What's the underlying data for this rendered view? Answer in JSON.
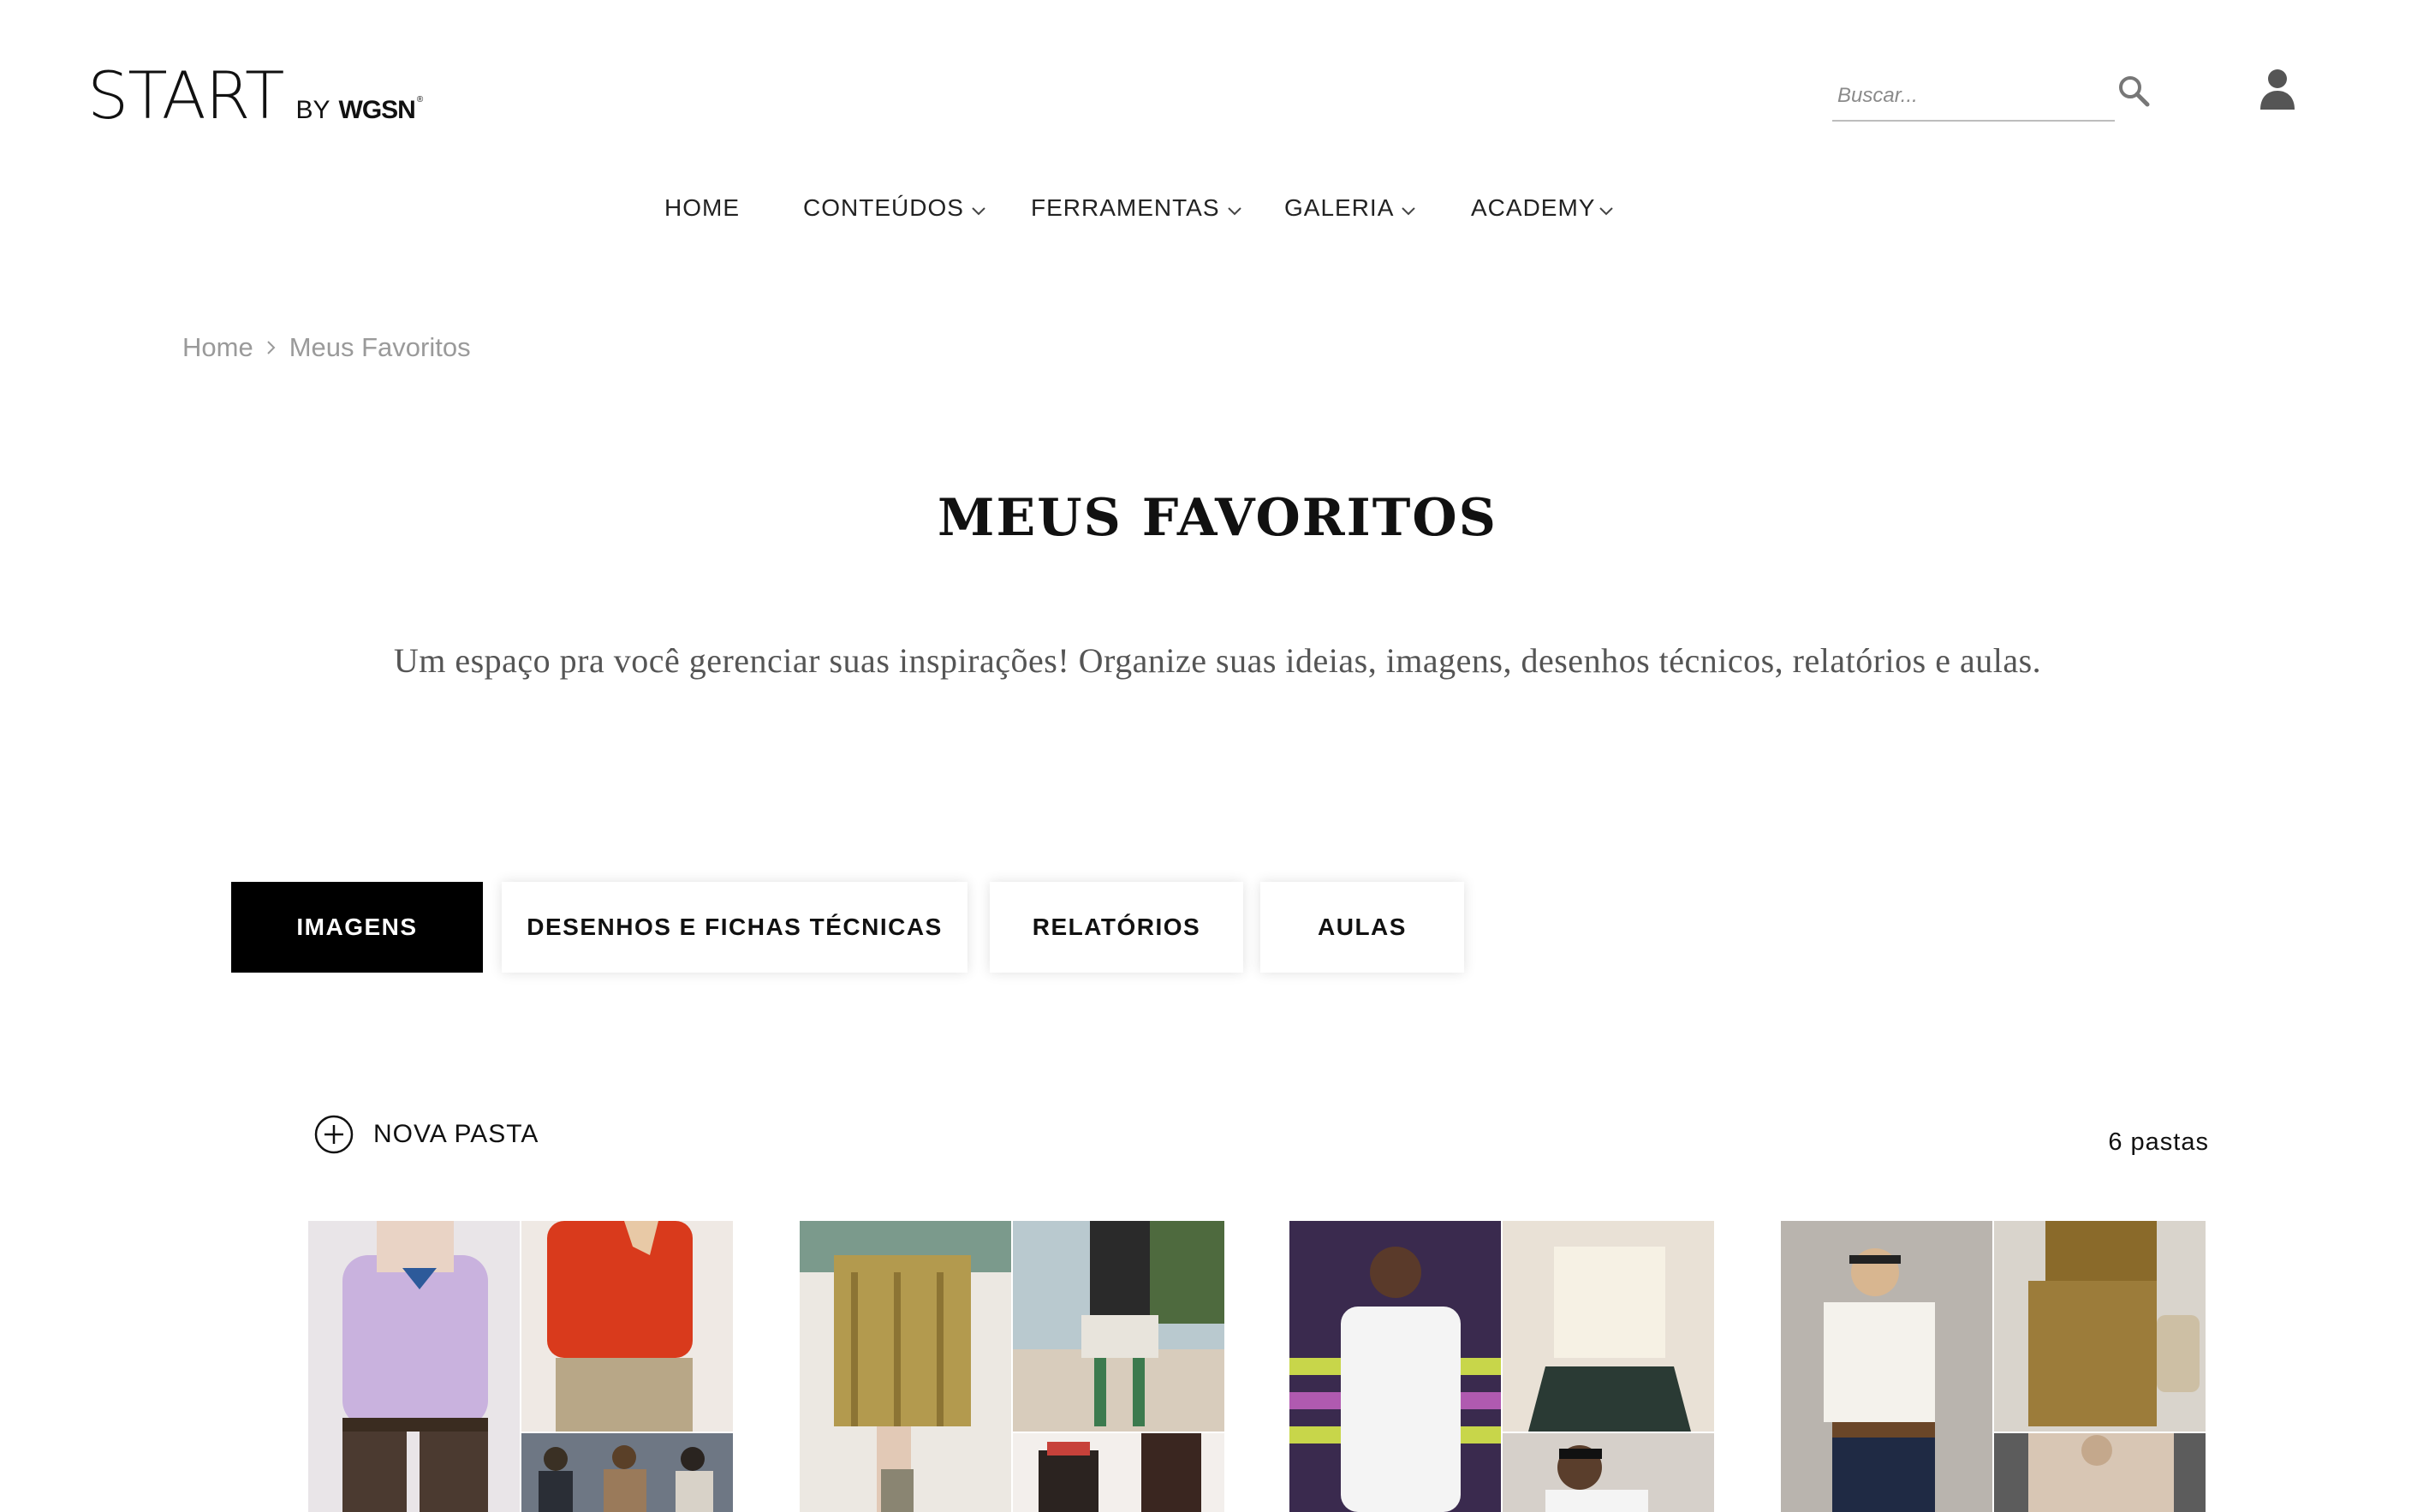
{
  "logo": {
    "main": "START",
    "by": "BY",
    "brand": "WGSN",
    "reg": "®"
  },
  "search": {
    "placeholder": "Buscar..."
  },
  "nav": {
    "home": "HOME",
    "conteudos": "CONTEÚDOS",
    "ferramentas": "FERRAMENTAS",
    "galeria": "GALERIA",
    "academy": "ACADEMY"
  },
  "breadcrumb": {
    "home": "Home",
    "current": "Meus Favoritos"
  },
  "page": {
    "title": "MEUS FAVORITOS",
    "subtitle": "Um espaço pra você gerenciar suas inspirações! Organize suas ideias, imagens, desenhos técnicos, relatórios e aulas."
  },
  "tabs": [
    {
      "label": "IMAGENS",
      "active": true
    },
    {
      "label": "DESENHOS E FICHAS TÉCNICAS",
      "active": false
    },
    {
      "label": "RELATÓRIOS",
      "active": false
    },
    {
      "label": "AULAS",
      "active": false
    }
  ],
  "folders_toolbar": {
    "new_folder": "NOVA PASTA",
    "count": "6 pastas"
  },
  "icons": [
    "search-icon",
    "user-icon",
    "chevron-down-icon",
    "chevron-right-icon",
    "plus-circle-icon"
  ],
  "colors": {
    "accent": "#000000",
    "breadcrumb": "#9a9a9a",
    "subtitle": "#555555"
  }
}
